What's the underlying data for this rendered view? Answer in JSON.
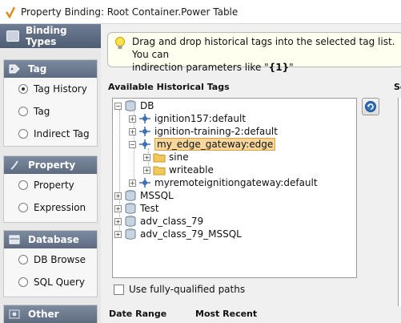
{
  "window": {
    "title": "Property Binding: Root Container.Power Table"
  },
  "sidebar": {
    "header": "Binding Types",
    "groups": [
      {
        "title": "Tag",
        "icon": "tag-icon",
        "options": [
          {
            "label": "Tag History",
            "selected": true
          },
          {
            "label": "Tag",
            "selected": false
          },
          {
            "label": "Indirect Tag",
            "selected": false
          }
        ]
      },
      {
        "title": "Property",
        "icon": "property-icon",
        "options": [
          {
            "label": "Property",
            "selected": false
          },
          {
            "label": "Expression",
            "selected": false
          }
        ]
      },
      {
        "title": "Database",
        "icon": "database-icon",
        "options": [
          {
            "label": "DB Browse",
            "selected": false
          },
          {
            "label": "SQL Query",
            "selected": false
          }
        ]
      },
      {
        "title": "Other",
        "icon": "other-icon",
        "options": []
      }
    ]
  },
  "tip": {
    "line1": "Drag and drop historical tags into the selected tag list. You can",
    "line2_prefix": "indirection parameters like \"",
    "line2_param": "{1}",
    "line2_suffix": "\""
  },
  "available_tags": {
    "label": "Available Historical Tags",
    "tree": {
      "root": "DB",
      "providers": [
        "ignition157:default",
        "ignition-training-2:default",
        "my_edge_gateway:edge",
        "myremoteignitiongateway:default"
      ],
      "edge_children": [
        "sine",
        "writeable"
      ],
      "other_roots": [
        "MSSQL",
        "Test",
        "adv_class_79",
        "adv_class_79_MSSQL"
      ]
    },
    "selected": "my_edge_gateway:edge"
  },
  "options": {
    "fully_qualified_label": "Use fully-qualified paths"
  },
  "footer": {
    "date_range_label": "Date Range",
    "most_recent_label": "Most Recent"
  },
  "right_panel": {
    "header_fragment": "Se"
  },
  "colors": {
    "header_bg": "#5e6b80",
    "selection_bg": "#f7d79b",
    "tip_bg": "#fffff0"
  }
}
